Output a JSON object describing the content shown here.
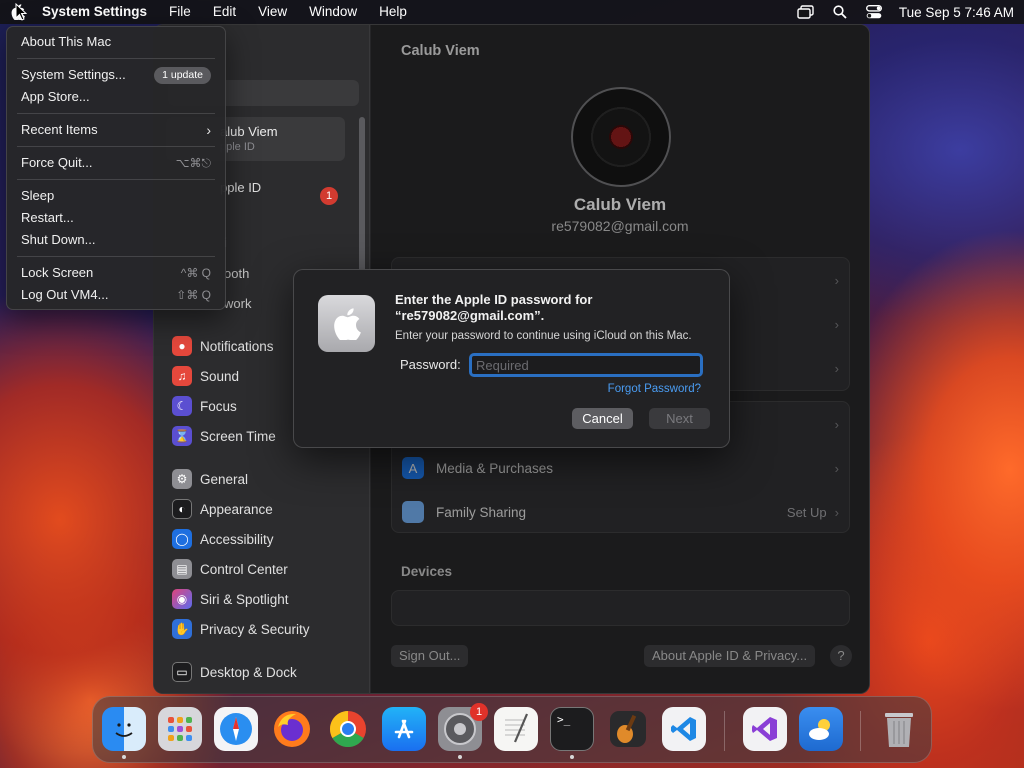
{
  "menubar": {
    "app_name": "System Settings",
    "items": [
      "File",
      "Edit",
      "View",
      "Window",
      "Help"
    ],
    "clock": "Tue Sep 5  7:46 AM"
  },
  "apple_menu": {
    "about": "About This Mac",
    "system_settings": "System Settings...",
    "update_badge": "1 update",
    "app_store": "App Store...",
    "recent_items": "Recent Items",
    "force_quit": "Force Quit...",
    "force_quit_shortcut": "⌥⌘⎋",
    "sleep": "Sleep",
    "restart": "Restart...",
    "shut_down": "Shut Down...",
    "lock_screen": "Lock Screen",
    "lock_screen_shortcut": "^⌘ Q",
    "log_out": "Log Out VM4...",
    "log_out_shortcut": "⇧⌘ Q"
  },
  "sidebar": {
    "profile_name": "alub Viem",
    "profile_sub": "pple ID",
    "apple_id_row": "pple ID",
    "apple_id_badge": "1",
    "frag_wifi": "i",
    "frag_bluetooth": "ooth",
    "frag_network": "work",
    "items": [
      {
        "label": "Notifications",
        "color": "#e5483c",
        "glyph": "🔔"
      },
      {
        "label": "Sound",
        "color": "#e5483c",
        "glyph": "🔊"
      },
      {
        "label": "Focus",
        "color": "#5b4fd1",
        "glyph": "☾"
      },
      {
        "label": "Screen Time",
        "color": "#5b4fd1",
        "glyph": "⧗"
      },
      {
        "label": "General",
        "color": "#8e8e93",
        "glyph": "⚙"
      },
      {
        "label": "Appearance",
        "color": "#1c1c1e",
        "glyph": "◐"
      },
      {
        "label": "Accessibility",
        "color": "#1e6fe0",
        "glyph": "ⓘ"
      },
      {
        "label": "Control Center",
        "color": "#8e8e93",
        "glyph": "▤"
      },
      {
        "label": "Siri & Spotlight",
        "color": "#b34ad6",
        "glyph": "◉"
      },
      {
        "label": "Privacy & Security",
        "color": "#2f6fd8",
        "glyph": "✋"
      },
      {
        "label": "Desktop & Dock",
        "color": "#1c1c1e",
        "glyph": "▭"
      }
    ]
  },
  "content": {
    "title": "Calub Viem",
    "user_name": "Calub Viem",
    "user_email": "re579082@gmail.com",
    "media_purchases": "Media & Purchases",
    "family_sharing": "Family Sharing",
    "family_value": "Set Up",
    "devices_title": "Devices",
    "sign_out": "Sign Out...",
    "about_privacy": "About Apple ID & Privacy...",
    "help": "?"
  },
  "dialog": {
    "heading": "Enter the Apple ID password for “re579082@gmail.com”.",
    "subtext": "Enter your password to continue using iCloud on this Mac.",
    "password_label": "Password:",
    "password_placeholder": "Required",
    "forgot": "Forgot Password?",
    "cancel": "Cancel",
    "next": "Next"
  },
  "dock": {
    "settings_badge": "1",
    "apps": [
      "Finder",
      "Launchpad",
      "Safari",
      "Firefox",
      "Chrome",
      "App Store",
      "System Settings",
      "TextEdit",
      "Terminal",
      "GarageBand",
      "Visual Studio Code",
      "Visual Studio",
      "Weather",
      "Trash"
    ]
  }
}
